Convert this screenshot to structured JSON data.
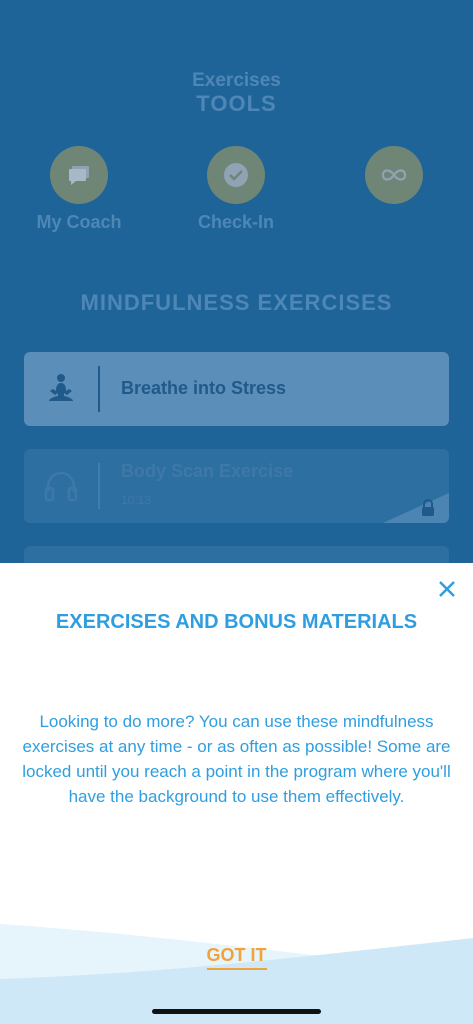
{
  "header": {
    "subtitle": "Exercises",
    "title": "TOOLS"
  },
  "tools": [
    {
      "label": "My Coach",
      "icon": "chat-icon"
    },
    {
      "label": "Check-In",
      "icon": "check-icon"
    },
    {
      "label": "",
      "icon": "infinity-icon"
    }
  ],
  "section": {
    "title": "MINDFULNESS EXERCISES"
  },
  "exercises": [
    {
      "title": "Breathe into Stress",
      "icon": "meditation-icon",
      "locked": false
    },
    {
      "title": "Body Scan Exercise",
      "duration": "10:13",
      "icon": "headphones-icon",
      "locked": true
    }
  ],
  "modal": {
    "title": "EXERCISES AND BONUS MATERIALS",
    "body": "Looking to do more? You can use these mindfulness exercises at any time - or as often as possible!  Some are locked until you reach a point in the program where you'll have the background to use them effectively.",
    "button": "GOT IT"
  },
  "colors": {
    "background": "#1f6498",
    "accent": "#2f9ee0",
    "button": "#f0a33b"
  }
}
